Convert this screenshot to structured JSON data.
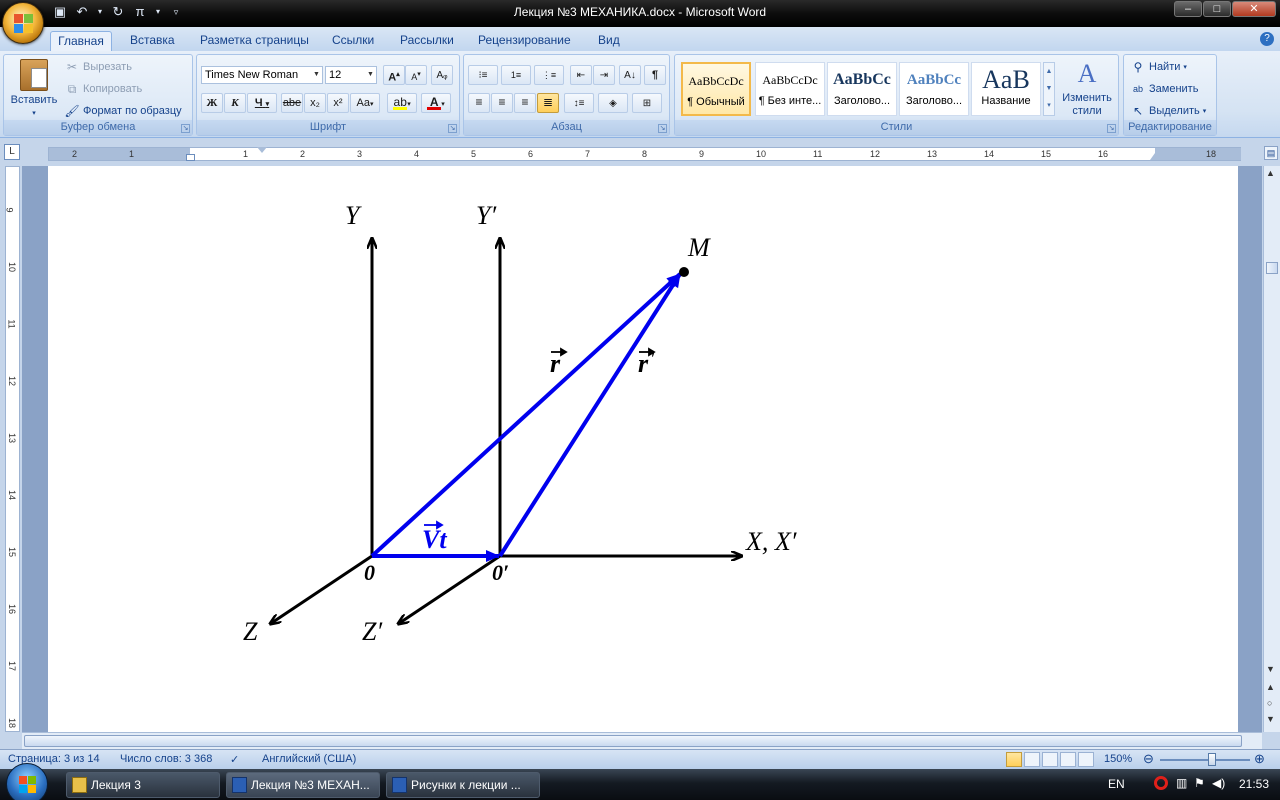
{
  "window": {
    "title": "Лекция №3 МЕХАНИКА.docx - Microsoft Word",
    "buttons": {
      "minimize": "–",
      "maximize": "□",
      "close": "✕"
    }
  },
  "tabs": [
    "Главная",
    "Вставка",
    "Разметка страницы",
    "Ссылки",
    "Рассылки",
    "Рецензирование",
    "Вид"
  ],
  "ribbon": {
    "clipboard": {
      "label": "Буфер обмена",
      "paste": "Вставить",
      "cut": "Вырезать",
      "copy": "Копировать",
      "format_painter": "Формат по образцу"
    },
    "font": {
      "label": "Шрифт",
      "font_name": "Times New Roman",
      "font_size": "12",
      "bold": "Ж",
      "italic": "К",
      "underline": "Ч",
      "strike": "abe",
      "sub": "x₂",
      "sup": "x²",
      "case": "Aa",
      "grow": "A",
      "shrink": "A"
    },
    "paragraph": {
      "label": "Абзац",
      "pilcrow": "¶"
    },
    "styles": {
      "label": "Стили",
      "items": [
        {
          "sample": "AaBbCcDc",
          "name": "¶ Обычный"
        },
        {
          "sample": "AaBbCcDc",
          "name": "¶ Без инте..."
        },
        {
          "sample": "AaBbCc",
          "name": "Заголово..."
        },
        {
          "sample": "AaBbCc",
          "name": "Заголово..."
        },
        {
          "sample": "AaB",
          "name": "Название"
        }
      ],
      "change_styles": "Изменить стили"
    },
    "editing": {
      "label": "Редактирование",
      "find": "Найти",
      "replace": "Заменить",
      "select": "Выделить"
    }
  },
  "ruler": {
    "h_ticks": [
      "2",
      "1",
      "1",
      "2",
      "3",
      "4",
      "5",
      "6",
      "7",
      "8",
      "9",
      "10",
      "11",
      "12",
      "13",
      "14",
      "15",
      "16",
      "18"
    ],
    "v_ticks": [
      "9",
      "10",
      "11",
      "12",
      "13",
      "14",
      "15",
      "16",
      "17",
      "18"
    ]
  },
  "figure": {
    "axis_y": "Y",
    "axis_y_prime": "Y′",
    "axis_x": "X, X′",
    "axis_z": "Z",
    "axis_z_prime": "Z′",
    "origin": "0",
    "origin_prime": "0′",
    "point": "M",
    "vec_r": "r",
    "vec_r_prime": "r",
    "vec_vt": "Vt",
    "colors": {
      "vector": "#0000ee",
      "axis": "#000000"
    }
  },
  "status": {
    "page": "Страница: 3 из 14",
    "words": "Число слов: 3 368",
    "language": "Английский (США)",
    "zoom": "150%"
  },
  "taskbar": {
    "items": [
      "Лекция 3",
      "Лекция №3 МЕХАН...",
      "Рисунки к лекции ..."
    ],
    "lang": "EN",
    "time": "21:53"
  }
}
